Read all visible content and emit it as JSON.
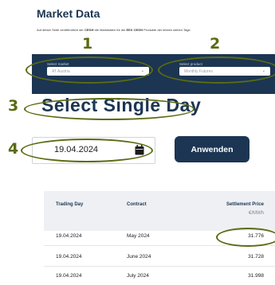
{
  "page": {
    "title": "Market Data",
    "intro_before": "Auf dieser Seite veröffentlicht der ",
    "intro_brand1": "CEGH",
    "intro_middle": " die Marktdaten für die ",
    "intro_brand2": "EEX CEGH",
    "intro_after": " Produkte der letzten sieben Tage."
  },
  "annotations": [
    "1",
    "2",
    "3",
    "4"
  ],
  "filters": {
    "market_label": "Select market",
    "market_value": "AT Austria",
    "product_label": "Select product",
    "product_value": "Monthly Futures"
  },
  "single_day": {
    "heading": "Select Single Day",
    "date_value": "19.04.2024",
    "apply_label": "Anwenden"
  },
  "table": {
    "headers": [
      "Trading Day",
      "Contract",
      "Settlement Price"
    ],
    "unit": "€/MWh",
    "rows": [
      [
        "19.04.2024",
        "May 2024",
        "31.776"
      ],
      [
        "19.04.2024",
        "June 2024",
        "31.728"
      ],
      [
        "19.04.2024",
        "July 2024",
        "31.998"
      ]
    ]
  },
  "colors": {
    "navy": "#1c3552",
    "annotation_olive": "#5a6b12"
  },
  "icons": [
    "chevron-down-icon",
    "calendar-icon"
  ]
}
